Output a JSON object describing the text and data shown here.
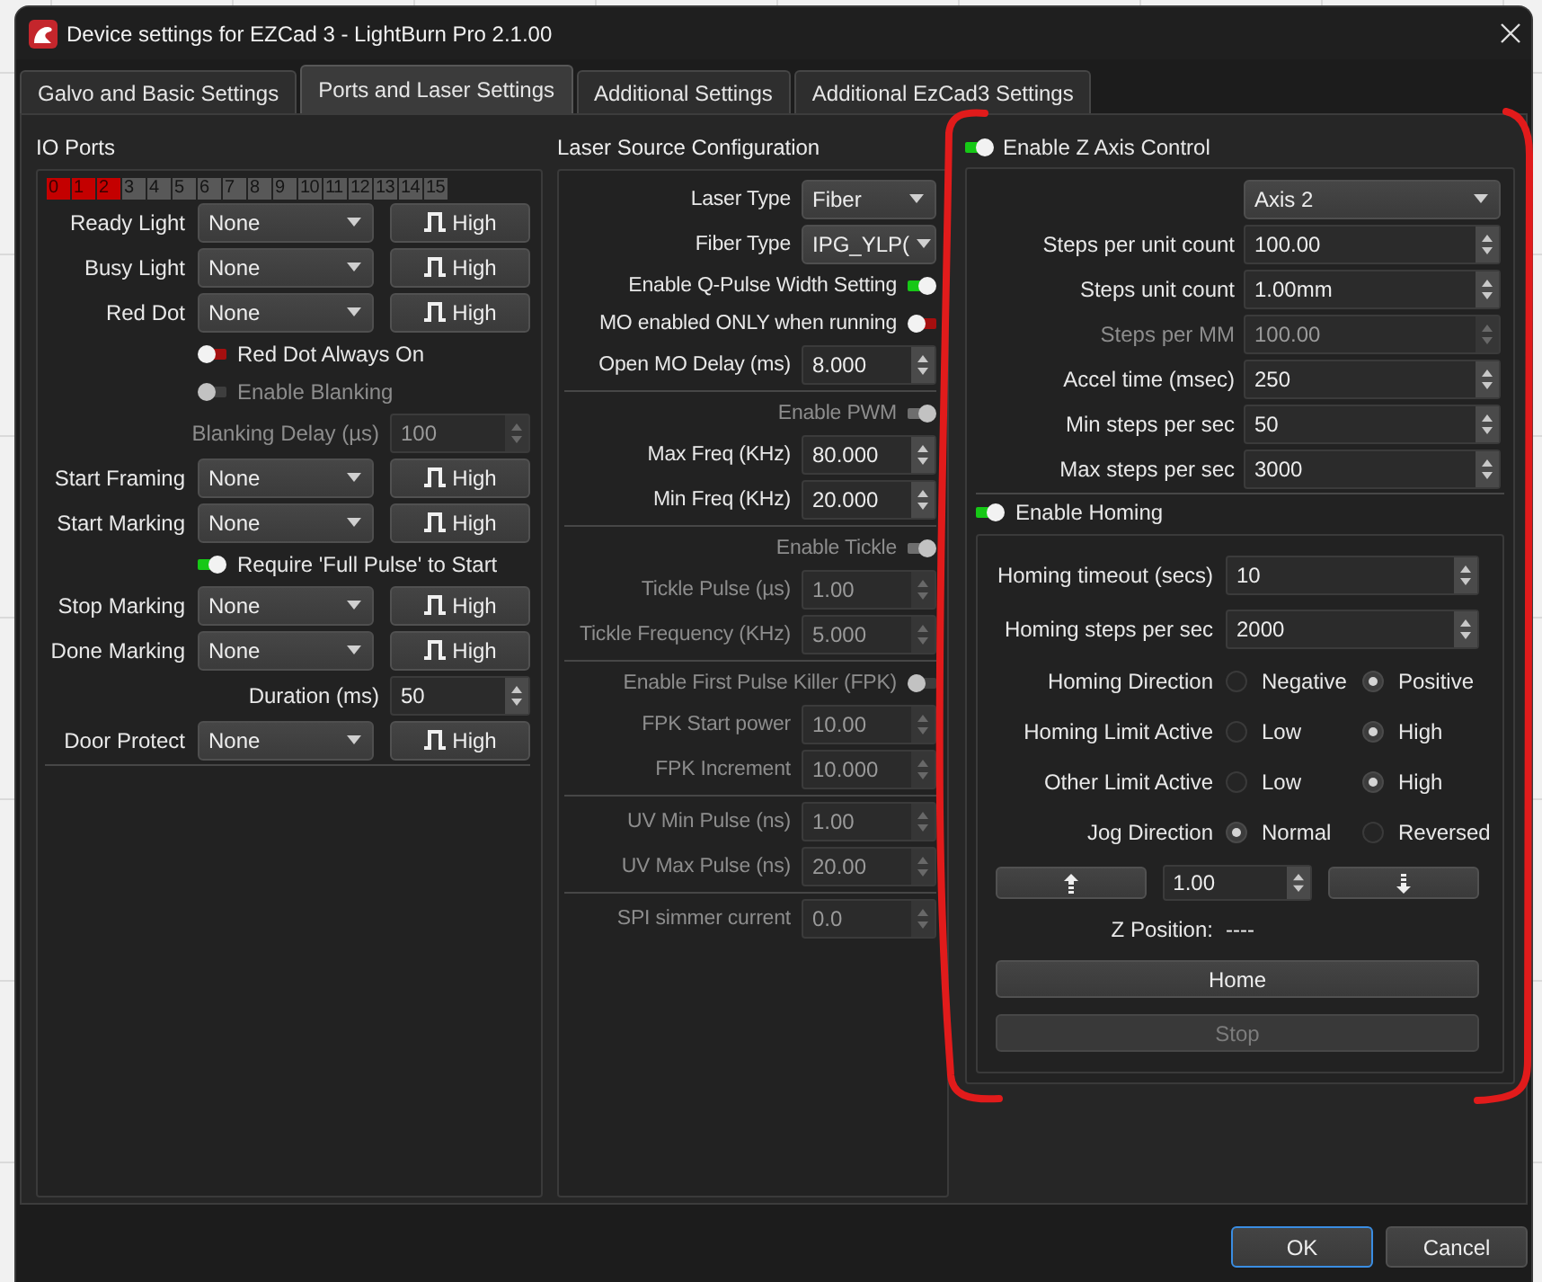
{
  "window": {
    "title": "Device settings for EZCad 3 - LightBurn Pro 2.1.00"
  },
  "tabs": [
    {
      "label": "Galvo and Basic Settings",
      "selected": false
    },
    {
      "label": "Ports and Laser Settings",
      "selected": true
    },
    {
      "label": "Additional Settings",
      "selected": false
    },
    {
      "label": "Additional EzCad3 Settings",
      "selected": false
    }
  ],
  "io_ports": {
    "title": "IO Ports",
    "bits": [
      {
        "label": "0",
        "on": true
      },
      {
        "label": "1",
        "on": true
      },
      {
        "label": "2",
        "on": true
      },
      {
        "label": "3",
        "on": false
      },
      {
        "label": "4",
        "on": false
      },
      {
        "label": "5",
        "on": false
      },
      {
        "label": "6",
        "on": false
      },
      {
        "label": "7",
        "on": false
      },
      {
        "label": "8",
        "on": false
      },
      {
        "label": "9",
        "on": false
      },
      {
        "label": "10",
        "on": false
      },
      {
        "label": "11",
        "on": false
      },
      {
        "label": "12",
        "on": false
      },
      {
        "label": "13",
        "on": false
      },
      {
        "label": "14",
        "on": false
      },
      {
        "label": "15",
        "on": false
      }
    ],
    "rows": [
      {
        "kind": "port",
        "label": "Ready Light",
        "value": "None",
        "active_level": "High"
      },
      {
        "kind": "port",
        "label": "Busy Light",
        "value": "None",
        "active_level": "High"
      },
      {
        "kind": "port",
        "label": "Red Dot",
        "value": "None",
        "active_level": "High"
      },
      {
        "kind": "toggle",
        "label": "Red Dot Always On",
        "on": false,
        "disabled": false
      },
      {
        "kind": "toggle",
        "label": "Enable Blanking",
        "on": false,
        "disabled": true
      },
      {
        "kind": "spin",
        "label": "Blanking Delay (µs)",
        "value": "100",
        "disabled": true
      },
      {
        "kind": "port",
        "label": "Start Framing",
        "value": "None",
        "active_level": "High"
      },
      {
        "kind": "port",
        "label": "Start Marking",
        "value": "None",
        "active_level": "High"
      },
      {
        "kind": "toggle",
        "label": "Require 'Full Pulse' to Start",
        "on": true,
        "disabled": false
      },
      {
        "kind": "port",
        "label": "Stop Marking",
        "value": "None",
        "active_level": "High"
      },
      {
        "kind": "port",
        "label": "Done Marking",
        "value": "None",
        "active_level": "High"
      },
      {
        "kind": "spin",
        "label": "Duration (ms)",
        "value": "50",
        "disabled": false
      },
      {
        "kind": "port",
        "label": "Door Protect",
        "value": "None",
        "active_level": "High"
      }
    ]
  },
  "laser_source": {
    "title": "Laser Source Configuration",
    "sections": [
      {
        "rows": [
          {
            "kind": "combo",
            "label": "Laser Type",
            "value": "Fiber"
          },
          {
            "kind": "combo",
            "label": "Fiber Type",
            "value": "IPG_YLP("
          },
          {
            "kind": "toggle",
            "label": "Enable Q-Pulse Width Setting",
            "on": true,
            "disabled": false
          },
          {
            "kind": "toggle",
            "label": "MO enabled ONLY when running",
            "on": false,
            "disabled": false
          },
          {
            "kind": "spin",
            "label": "Open MO Delay (ms)",
            "value": "8.000",
            "disabled": false
          }
        ]
      },
      {
        "rows": [
          {
            "kind": "toggle",
            "label": "Enable PWM",
            "on": true,
            "disabled": true
          },
          {
            "kind": "spin",
            "label": "Max Freq (KHz)",
            "value": "80.000",
            "disabled": false
          },
          {
            "kind": "spin",
            "label": "Min Freq (KHz)",
            "value": "20.000",
            "disabled": false
          }
        ]
      },
      {
        "rows": [
          {
            "kind": "toggle",
            "label": "Enable Tickle",
            "on": true,
            "disabled": true
          },
          {
            "kind": "spin",
            "label": "Tickle Pulse (µs)",
            "value": "1.00",
            "disabled": true
          },
          {
            "kind": "spin",
            "label": "Tickle Frequency (KHz)",
            "value": "5.000",
            "disabled": true
          }
        ]
      },
      {
        "rows": [
          {
            "kind": "toggle",
            "label": "Enable First Pulse Killer (FPK)",
            "on": false,
            "disabled": true
          },
          {
            "kind": "spin",
            "label": "FPK Start power",
            "value": "10.00",
            "disabled": true
          },
          {
            "kind": "spin",
            "label": "FPK Increment",
            "value": "10.000",
            "disabled": true
          }
        ]
      },
      {
        "rows": [
          {
            "kind": "spin",
            "label": "UV Min Pulse (ns)",
            "value": "1.00",
            "disabled": true
          },
          {
            "kind": "spin",
            "label": "UV Max Pulse (ns)",
            "value": "20.00",
            "disabled": true
          }
        ]
      },
      {
        "rows": [
          {
            "kind": "spin",
            "label": "SPI simmer current",
            "value": "0.0",
            "disabled": true
          }
        ]
      }
    ]
  },
  "z_axis": {
    "label": "Enable Z Axis Control",
    "on": true,
    "axis": "Axis 2",
    "rows": [
      {
        "label": "Steps per unit count",
        "value": "100.00",
        "disabled": false
      },
      {
        "label": "Steps unit count",
        "value": "1.00mm",
        "disabled": false
      },
      {
        "label": "Steps per MM",
        "value": "100.00",
        "disabled": true
      },
      {
        "label": "Accel time (msec)",
        "value": "250",
        "disabled": false
      },
      {
        "label": "Min steps per sec",
        "value": "50",
        "disabled": false
      },
      {
        "label": "Max steps per sec",
        "value": "3000",
        "disabled": false
      }
    ],
    "homing": {
      "label": "Enable Homing",
      "on": true,
      "rows": [
        {
          "label": "Homing timeout (secs)",
          "value": "10"
        },
        {
          "label": "Homing steps per sec",
          "value": "2000"
        }
      ],
      "radio_rows": [
        {
          "label": "Homing Direction",
          "options": [
            {
              "label": "Negative",
              "selected": false
            },
            {
              "label": "Positive",
              "selected": true
            }
          ]
        },
        {
          "label": "Homing Limit Active",
          "options": [
            {
              "label": "Low",
              "selected": false
            },
            {
              "label": "High",
              "selected": true
            }
          ]
        },
        {
          "label": "Other Limit Active",
          "options": [
            {
              "label": "Low",
              "selected": false
            },
            {
              "label": "High",
              "selected": true
            }
          ]
        },
        {
          "label": "Jog Direction",
          "options": [
            {
              "label": "Normal",
              "selected": true
            },
            {
              "label": "Reversed",
              "selected": false
            }
          ]
        }
      ],
      "jog_step": "1.00",
      "z_position": {
        "label": "Z Position:",
        "value": "----"
      },
      "actions": [
        {
          "label": "Home",
          "disabled": false
        },
        {
          "label": "Stop",
          "disabled": true
        }
      ]
    }
  },
  "buttons": [
    {
      "label": "OK",
      "default": true
    },
    {
      "label": "Cancel",
      "default": false
    }
  ],
  "annotation": {
    "kind": "hand-drawn-outline"
  }
}
